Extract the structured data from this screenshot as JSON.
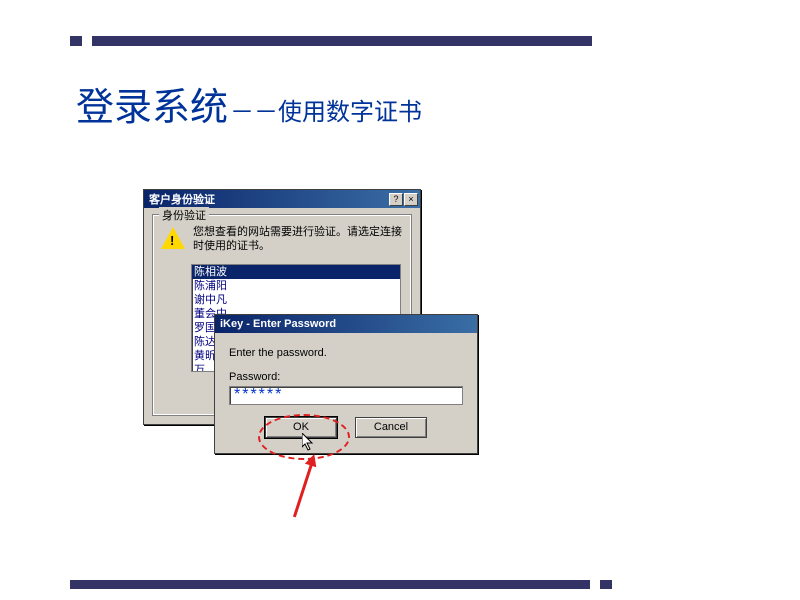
{
  "slide": {
    "title_main": "登录系统",
    "title_sub": "－－使用数字证书"
  },
  "dialog1": {
    "title": "客户身份验证",
    "groupbox_label": "身份验证",
    "warn_text": "您想查看的网站需要进行验证。请选定连接时使用的证书。",
    "certs": [
      "陈相波",
      "陈浦阳",
      "谢中凡",
      "董会中",
      "罗国新",
      "陈达强",
      "黄昕",
      "万"
    ]
  },
  "dialog2": {
    "title": "iKey - Enter Password",
    "prompt": "Enter the password.",
    "pwd_label": "Password:",
    "pwd_value": "******",
    "ok_label": "OK",
    "cancel_label": "Cancel"
  },
  "titlebar_icons": {
    "help": "?",
    "close": "×"
  }
}
